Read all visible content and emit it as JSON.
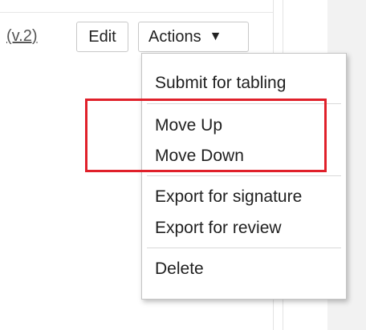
{
  "toolbar": {
    "version_label": "(v.2)",
    "edit_label": "Edit",
    "actions_label": "Actions",
    "actions_caret": "▼"
  },
  "actions_menu": {
    "items": [
      {
        "label": "Submit for tabling"
      },
      {
        "label": "Move Up"
      },
      {
        "label": "Move Down"
      },
      {
        "label": "Export for signature"
      },
      {
        "label": "Export for review"
      },
      {
        "label": "Delete"
      }
    ]
  },
  "highlight": {
    "color": "#e0202a"
  }
}
